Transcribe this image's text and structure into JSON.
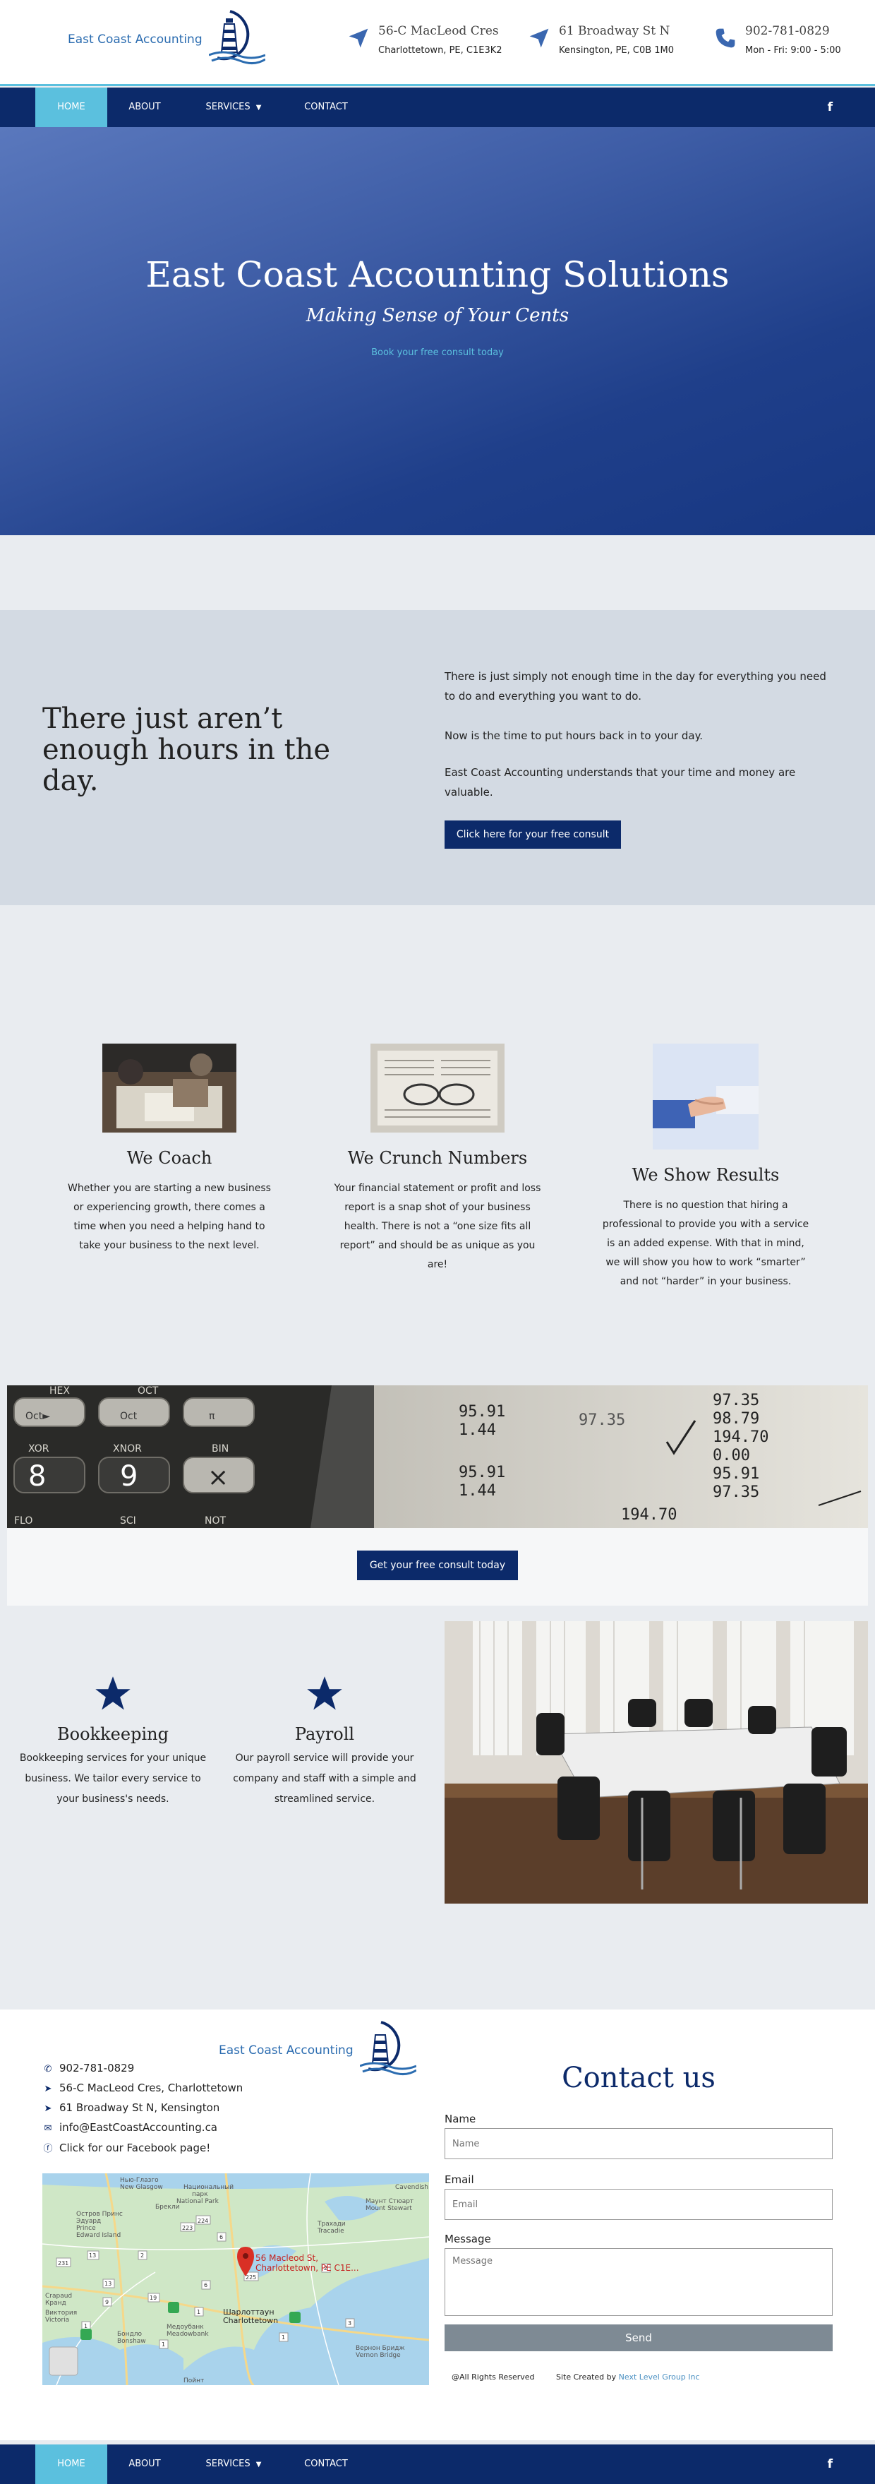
{
  "brand": {
    "name": "East Coast Accounting"
  },
  "header": {
    "address1": {
      "line1": "56-C MacLeod Cres",
      "line2": "Charlottetown, PE, C1E3K2"
    },
    "address2": {
      "line1": "61 Broadway St N",
      "line2": "Kensington, PE, C0B 1M0"
    },
    "phone": {
      "line1": "902-781-0829",
      "line2": "Mon - Fri: 9:00 - 5:00"
    }
  },
  "nav": {
    "home": "HOME",
    "about": "ABOUT",
    "services": "SERVICES",
    "contact": "CONTACT",
    "facebook": "f"
  },
  "hero": {
    "title": "East Coast Accounting Solutions",
    "subtitle": "Making Sense of Your Cents",
    "link": "Book your free consult today"
  },
  "hours": {
    "heading": "There just aren’t enough hours in the day.",
    "p1": "There is just simply not enough time in the day for everything you need to do and everything you want to do.",
    "p2": "Now is the time to put hours back in to your day.",
    "p3": "East Coast Accounting understands that your time and money are valuable.",
    "button": "Click here for your free consult"
  },
  "features": [
    {
      "title": "We Coach",
      "text": "Whether you are starting a new business or experiencing growth, there comes a time when you need a helping hand to take your business to the next level."
    },
    {
      "title": "We Crunch Numbers",
      "text": "Your financial statement or profit and loss report is a snap shot of your business health. There is not a “one size fits all report” and should be as unique as you are!"
    },
    {
      "title": "We Show Results",
      "text": "There is no question that hiring a professional to provide you with a service is an added expense. With that in mind, we will show you how to work “smarter” and not “harder” in your business."
    }
  ],
  "calculator": {
    "keys": [
      "HEX",
      "OCT",
      "Oct",
      "XOR",
      "XNOR",
      "BIN",
      "FLO",
      "SCI",
      "NOT",
      "8",
      "9",
      "×",
      "π",
      "Oct►"
    ],
    "numbers": [
      "95.91",
      "1.44",
      "97.35",
      "95.91",
      "97.35",
      "98.79",
      "194.70",
      "0.00",
      "95.91",
      "97.35",
      "1.44",
      "194.70"
    ]
  },
  "consult_band": {
    "button": "Get your free consult today"
  },
  "services": [
    {
      "title": "Bookkeeping",
      "text": "Bookkeeping services for your unique business. We tailor every service to your business's needs."
    },
    {
      "title": "Payroll",
      "text": "Our payroll service will provide your company and staff with a simple and streamlined service."
    }
  ],
  "contact": {
    "phone": "902-781-0829",
    "address1": "56-C MacLeod Cres, Charlottetown",
    "address2": "61 Broadway St N, Kensington",
    "email": "info@EastCoastAccounting.ca",
    "facebook": "Click for our Facebook page!",
    "title": "Contact us",
    "name_label": "Name",
    "name_placeholder": "Name",
    "email_label": "Email",
    "email_placeholder": "Email",
    "message_label": "Message",
    "message_placeholder": "Message",
    "send": "Send",
    "rights": "@All Rights Reserved",
    "credit_prefix": "Site Created by",
    "credit_link": "Next Level Group Inc"
  },
  "map": {
    "pin_label1": "56 Macleod St,",
    "pin_label2": "Charlottetown, PE C1E...",
    "places": [
      "Нью-Глазго",
      "New Glasgow",
      "Национальный",
      "парк",
      "Остров Принс",
      "Эдуард",
      "Prince",
      "Edward Island",
      "National Park",
      "Cavendish",
      "Брекли",
      "Маунт Стюарт",
      "Mount Stewart",
      "Шарлоттаун",
      "Charlottetown",
      "Виктория",
      "Victoria",
      "Вернон Бридж",
      "Vernon Bridge",
      "Медоубанк",
      "Meadowbank",
      "Бондло",
      "Bonshaw",
      "Трахади",
      "Tracadie",
      "Кранд",
      "Crapaud",
      "Пойнт"
    ],
    "roads": [
      "224",
      "6",
      "2",
      "225",
      "223",
      "13",
      "231",
      "13",
      "6",
      "2",
      "19",
      "9",
      "1",
      "3",
      "1",
      "1",
      "1"
    ]
  }
}
